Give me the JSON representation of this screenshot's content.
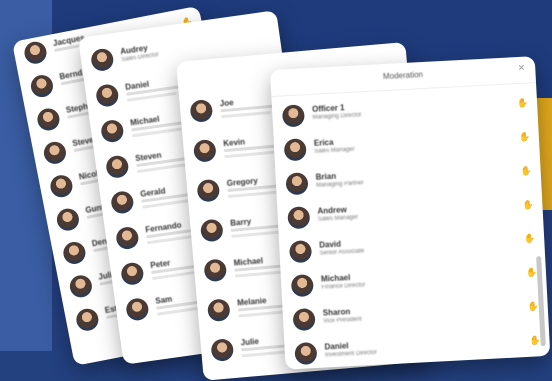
{
  "panel_moderation": {
    "title": "Moderation",
    "people": [
      {
        "name": "Officer 1",
        "role": "Managing Director"
      },
      {
        "name": "Erica",
        "role": "Sales Manager"
      },
      {
        "name": "Brian",
        "role": "Managing Partner"
      },
      {
        "name": "Andrew",
        "role": "Sales Manager"
      },
      {
        "name": "David",
        "role": "Senior Associate"
      },
      {
        "name": "Michael",
        "role": "Finance Director"
      },
      {
        "name": "Sharon",
        "role": "Vice President"
      },
      {
        "name": "Daniel",
        "role": "Investment Director"
      }
    ]
  },
  "panel_three": {
    "people": [
      {
        "name": "Joe"
      },
      {
        "name": "Kevin"
      },
      {
        "name": "Gregory"
      },
      {
        "name": "Barry"
      },
      {
        "name": "Michael"
      },
      {
        "name": "Melanie"
      },
      {
        "name": "Julie"
      }
    ]
  },
  "panel_two": {
    "people": [
      {
        "name": "Audrey",
        "role": "Sales Director"
      },
      {
        "name": "Daniel"
      },
      {
        "name": "Michael"
      },
      {
        "name": "Steven"
      },
      {
        "name": "Gerald"
      },
      {
        "name": "Fernando"
      },
      {
        "name": "Peter"
      },
      {
        "name": "Sam"
      }
    ]
  },
  "panel_one": {
    "people": [
      {
        "name": "Jacques"
      },
      {
        "name": "Bernd"
      },
      {
        "name": "Stephen"
      },
      {
        "name": "Steven"
      },
      {
        "name": "Nicole"
      },
      {
        "name": "Gunther"
      },
      {
        "name": "Dennis"
      },
      {
        "name": "Julie"
      },
      {
        "name": "Esther"
      }
    ]
  },
  "icons": {
    "raise_hand": "hand-icon",
    "close": "close-icon"
  }
}
